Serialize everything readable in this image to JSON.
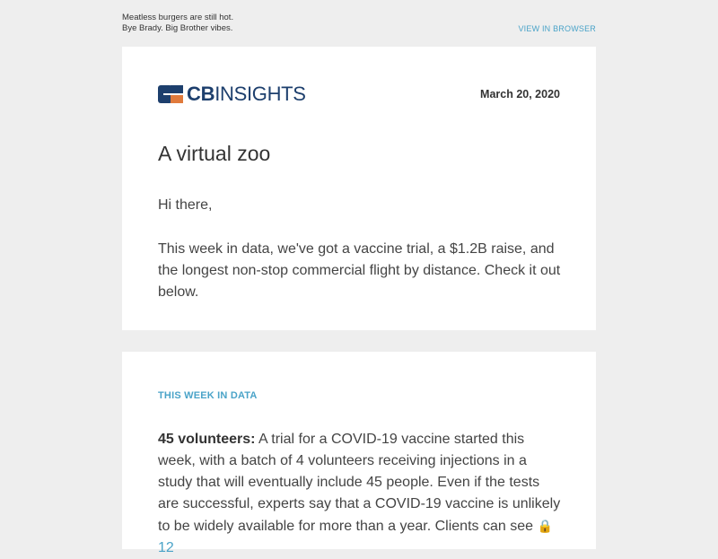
{
  "preheader": {
    "line1": "Meatless burgers are still hot.",
    "line2": "Bye Brady. Big Brother vibes.",
    "view_in_browser": "VIEW IN BROWSER"
  },
  "header": {
    "logo_bold": "CB",
    "logo_rest": "INSIGHTS",
    "date": "March 20, 2020"
  },
  "intro": {
    "headline": "A virtual zoo",
    "greeting": "Hi there,",
    "body": "This week in data, we've got a vaccine trial, a $1.2B raise, and the longest non-stop commercial flight by distance. Check it out below."
  },
  "data_section": {
    "label": "THIS WEEK IN DATA",
    "item1": {
      "lead": "45 volunteers:",
      "text": " A trial for a COVID-19 vaccine started this week, with a batch of 4 volunteers receiving injections in a study that will eventually include 45 people. Even if the tests are successful, experts say that a COVID-19 vaccine is unlikely to be widely available for more than a year. Clients can see ",
      "lock_icon": "🔒",
      "link": "12"
    }
  },
  "colors": {
    "accent": "#4aa3c8",
    "brand_navy": "#1d3f6d",
    "brand_orange": "#e07a3c",
    "background": "#eeeeee"
  }
}
